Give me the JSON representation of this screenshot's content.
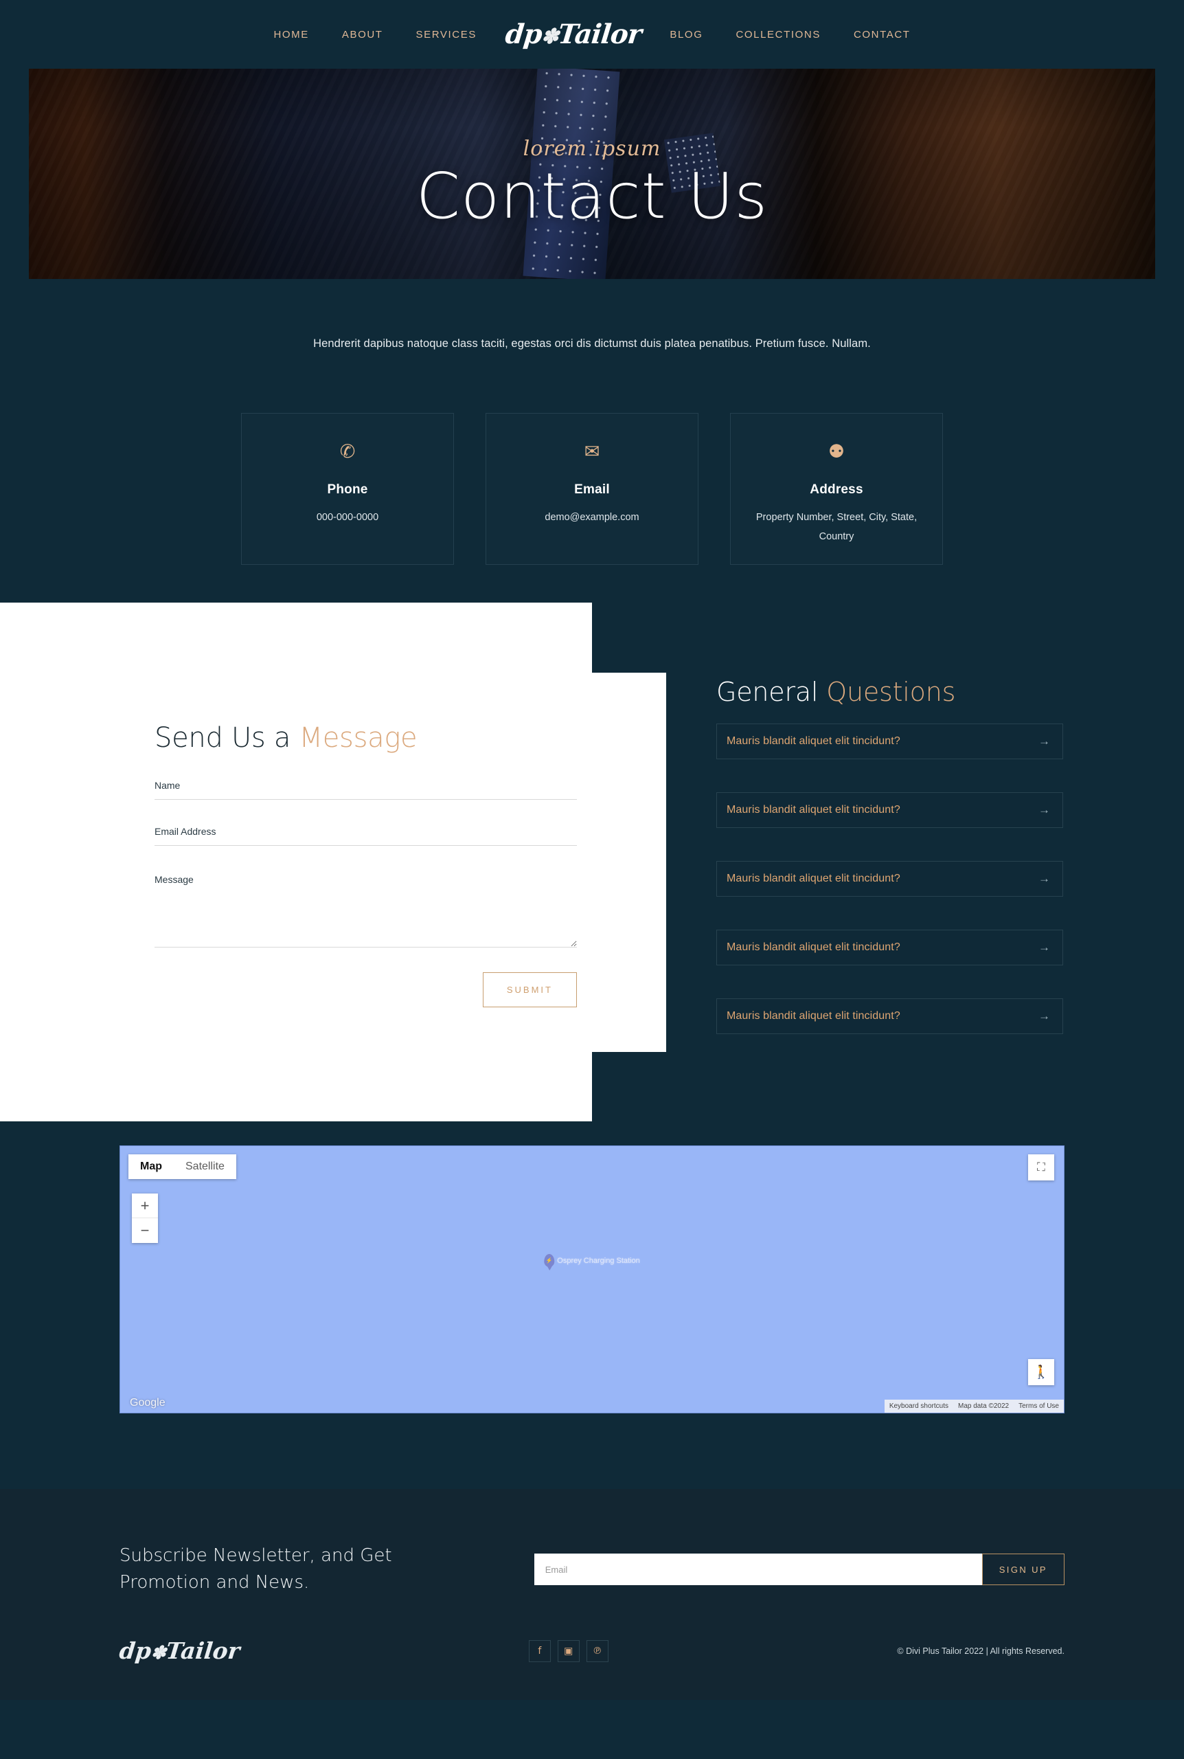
{
  "brand": {
    "logo_text": "dp",
    "logo_text2": "Tailor"
  },
  "nav": {
    "items": [
      {
        "label": "HOME"
      },
      {
        "label": "ABOUT"
      },
      {
        "label": "SERVICES"
      },
      {
        "label": "BLOG"
      },
      {
        "label": "COLLECTIONS"
      },
      {
        "label": "CONTACT"
      }
    ]
  },
  "hero": {
    "subtitle": "lorem ipsum",
    "title": "Contact Us"
  },
  "intro": {
    "text": "Hendrerit dapibus natoque class taciti, egestas orci dis dictumst duis platea penatibus. Pretium fusce. Nullam."
  },
  "contact_cards": [
    {
      "icon": "phone-icon",
      "glyph": "✆",
      "title": "Phone",
      "value": "000-000-0000"
    },
    {
      "icon": "email-icon",
      "glyph": "✉",
      "title": "Email",
      "value": "demo@example.com"
    },
    {
      "icon": "map-pin-icon",
      "glyph": "⚉",
      "title": "Address",
      "value": "Property Number, Street, City, State, Country"
    }
  ],
  "form": {
    "title_plain": "Send Us a ",
    "title_accent": "Message",
    "name_placeholder": "Name",
    "name_value": "",
    "email_placeholder": "Email Address",
    "email_value": "",
    "message_placeholder": "Message",
    "message_value": "",
    "submit_label": "SUBMIT"
  },
  "faq": {
    "title_plain": "General ",
    "title_accent": "Questions",
    "items": [
      {
        "question": "Mauris blandit aliquet elit tincidunt?",
        "arrow": "→"
      },
      {
        "question": "Mauris blandit aliquet elit tincidunt?",
        "arrow": "→"
      },
      {
        "question": "Mauris blandit aliquet elit tincidunt?",
        "arrow": "→"
      },
      {
        "question": "Mauris blandit aliquet elit tincidunt?",
        "arrow": "→"
      },
      {
        "question": "Mauris blandit aliquet elit tincidunt?",
        "arrow": "→"
      }
    ]
  },
  "map": {
    "type_map": "Map",
    "type_satellite": "Satellite",
    "zoom_in": "+",
    "zoom_out": "−",
    "fullscreen_icon": "⛶",
    "pegman_icon": "🚶",
    "marker_label": "Osprey Charging Station",
    "marker_glyph": "⚡",
    "attribution": "Google",
    "footer_items": [
      "Keyboard shortcuts",
      "Map data ©2022",
      "Terms of Use"
    ]
  },
  "newsletter": {
    "heading": "Subscribe Newsletter, and Get Promotion and News.",
    "email_placeholder": "Email",
    "email_value": "",
    "button_label": "SIGN UP"
  },
  "footer": {
    "socials": [
      {
        "name": "facebook-icon",
        "glyph": "f"
      },
      {
        "name": "instagram-icon",
        "glyph": "▣"
      },
      {
        "name": "pinterest-icon",
        "glyph": "℗"
      }
    ],
    "copyright": "© Divi Plus Tailor 2022 | All rights Reserved."
  },
  "colors": {
    "bg_dark": "#0f2a38",
    "footer_bg": "#132632",
    "accent": "#dba97e",
    "accent_border": "#c79e6f",
    "text_light": "#ffffff"
  }
}
